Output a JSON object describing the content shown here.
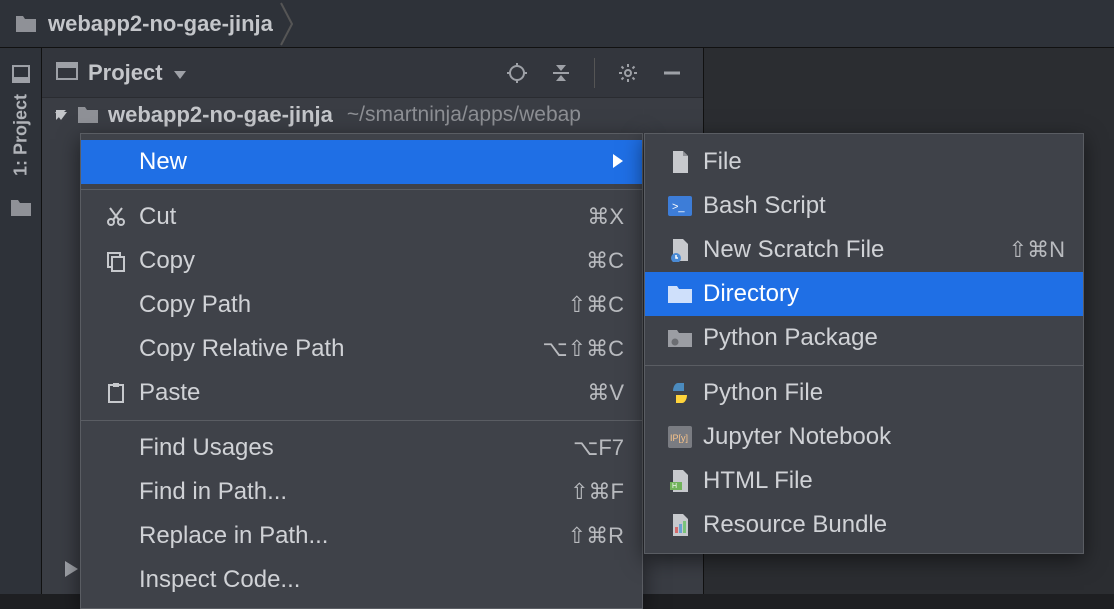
{
  "breadcrumb": {
    "project_name": "webapp2-no-gae-jinja"
  },
  "sidebar": {
    "tab_label": "1: Project"
  },
  "tool_window": {
    "title": "Project",
    "root_name": "webapp2-no-gae-jinja",
    "root_path": "~/smartninja/apps/webap"
  },
  "context_menu": {
    "items": [
      {
        "label": "New",
        "has_submenu": true,
        "selected": true
      },
      {
        "divider": true
      },
      {
        "label": "Cut",
        "shortcut": "⌘X",
        "icon": "cut"
      },
      {
        "label": "Copy",
        "shortcut": "⌘C",
        "icon": "copy"
      },
      {
        "label": "Copy Path",
        "shortcut": "⇧⌘C"
      },
      {
        "label": "Copy Relative Path",
        "shortcut": "⌥⇧⌘C"
      },
      {
        "label": "Paste",
        "shortcut": "⌘V",
        "icon": "paste"
      },
      {
        "divider": true
      },
      {
        "label": "Find Usages",
        "shortcut": "⌥F7"
      },
      {
        "label": "Find in Path...",
        "shortcut": "⇧⌘F"
      },
      {
        "label": "Replace in Path...",
        "shortcut": "⇧⌘R"
      },
      {
        "label": "Inspect Code..."
      }
    ]
  },
  "new_submenu": {
    "items": [
      {
        "label": "File",
        "icon": "file"
      },
      {
        "label": "Bash Script",
        "icon": "bash"
      },
      {
        "label": "New Scratch File",
        "shortcut": "⇧⌘N",
        "icon": "scratch"
      },
      {
        "label": "Directory",
        "icon": "folder",
        "selected": true
      },
      {
        "label": "Python Package",
        "icon": "package"
      },
      {
        "divider": true
      },
      {
        "label": "Python File",
        "icon": "python"
      },
      {
        "label": "Jupyter Notebook",
        "icon": "jupyter"
      },
      {
        "label": "HTML File",
        "icon": "html"
      },
      {
        "label": "Resource Bundle",
        "icon": "bundle"
      }
    ]
  }
}
